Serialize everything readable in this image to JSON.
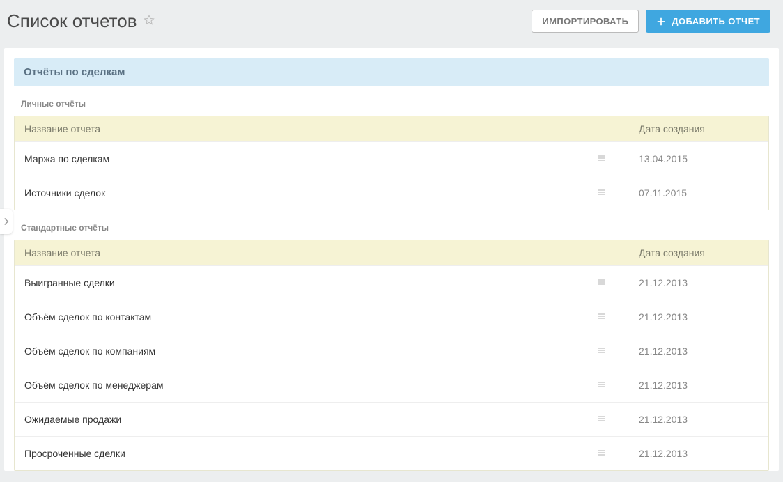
{
  "header": {
    "title": "Список отчетов",
    "import_label": "ИМПОРТИРОВАТЬ",
    "add_label": "ДОБАВИТЬ ОТЧЕТ"
  },
  "section": {
    "banner": "Отчёты по сделкам",
    "groups": [
      {
        "title": "Личные отчёты",
        "columns": {
          "name": "Название отчета",
          "date": "Дата создания"
        },
        "rows": [
          {
            "name": "Маржа по сделкам",
            "date": "13.04.2015"
          },
          {
            "name": "Источники сделок",
            "date": "07.11.2015"
          }
        ]
      },
      {
        "title": "Стандартные отчёты",
        "columns": {
          "name": "Название отчета",
          "date": "Дата создания"
        },
        "rows": [
          {
            "name": "Выигранные сделки",
            "date": "21.12.2013"
          },
          {
            "name": "Объём сделок по контактам",
            "date": "21.12.2013"
          },
          {
            "name": "Объём сделок по компаниям",
            "date": "21.12.2013"
          },
          {
            "name": "Объём сделок по менеджерам",
            "date": "21.12.2013"
          },
          {
            "name": "Ожидаемые продажи",
            "date": "21.12.2013"
          },
          {
            "name": "Просроченные сделки",
            "date": "21.12.2013"
          }
        ]
      }
    ]
  }
}
